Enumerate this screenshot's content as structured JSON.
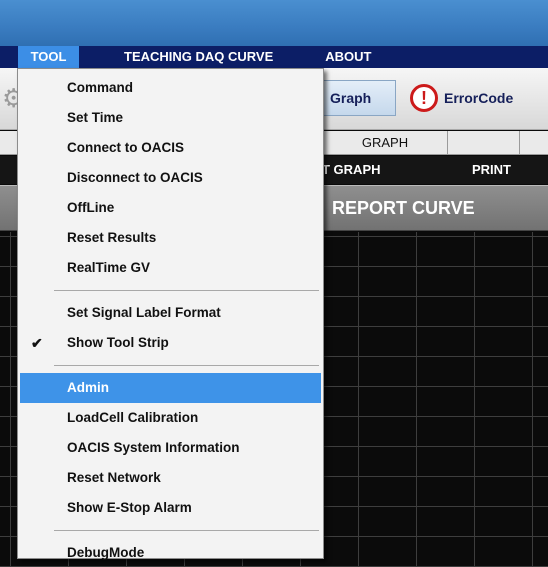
{
  "menubar": {
    "items": [
      {
        "label": "TOOL",
        "active": true
      },
      {
        "label": "TEACHING DAQ CURVE",
        "active": false
      },
      {
        "label": "ABOUT",
        "active": false
      }
    ]
  },
  "toolbar": {
    "graph_label": "Graph",
    "errorcode_label": "ErrorCode",
    "error_icon_glyph": "!"
  },
  "tabs": {
    "graph_tab": "GRAPH"
  },
  "subbar": {
    "graph_label": "T GRAPH",
    "print_label": "PRINT"
  },
  "report": {
    "title": "REPORT CURVE"
  },
  "dropdown": {
    "groups": [
      [
        {
          "label": "Command",
          "checked": false,
          "highlighted": false
        },
        {
          "label": "Set Time",
          "checked": false,
          "highlighted": false
        },
        {
          "label": "Connect to OACIS",
          "checked": false,
          "highlighted": false
        },
        {
          "label": "Disconnect to OACIS",
          "checked": false,
          "highlighted": false
        },
        {
          "label": "OffLine",
          "checked": false,
          "highlighted": false
        },
        {
          "label": "Reset Results",
          "checked": false,
          "highlighted": false
        },
        {
          "label": "RealTime GV",
          "checked": false,
          "highlighted": false
        }
      ],
      [
        {
          "label": "Set Signal Label Format",
          "checked": false,
          "highlighted": false
        },
        {
          "label": "Show Tool Strip",
          "checked": true,
          "highlighted": false
        }
      ],
      [
        {
          "label": "Admin",
          "checked": false,
          "highlighted": true
        },
        {
          "label": "LoadCell Calibration",
          "checked": false,
          "highlighted": false
        },
        {
          "label": "OACIS System Information",
          "checked": false,
          "highlighted": false
        },
        {
          "label": "Reset Network",
          "checked": false,
          "highlighted": false
        },
        {
          "label": "Show E-Stop Alarm",
          "checked": false,
          "highlighted": false
        }
      ],
      [
        {
          "label": "DebugMode",
          "checked": false,
          "highlighted": false
        }
      ]
    ]
  },
  "colors": {
    "menubar_bg": "#0c1e66",
    "menu_highlight": "#3e93e8",
    "error_red": "#cc1a1a"
  }
}
